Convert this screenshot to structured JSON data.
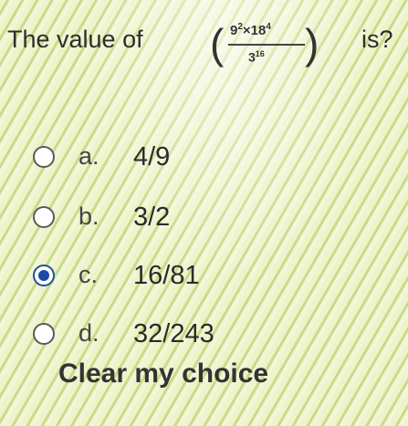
{
  "question": {
    "prefix": "The value of",
    "numerator_base1": "9",
    "numerator_exp1": "2",
    "numerator_times": "×",
    "numerator_base2": "18",
    "numerator_exp2": "4",
    "denominator_base": "3",
    "denominator_exp": "16",
    "left_paren": "(",
    "right_paren": ")",
    "suffix": "is?"
  },
  "options": [
    {
      "letter": "a.",
      "value": "4/9",
      "selected": false
    },
    {
      "letter": "b.",
      "value": "3/2",
      "selected": false
    },
    {
      "letter": "c.",
      "value": "16/81",
      "selected": true
    },
    {
      "letter": "d.",
      "value": "32/243",
      "selected": false
    }
  ],
  "clear_label": "Clear my choice",
  "colors": {
    "radio_selected": "#1a4aa8",
    "background": "#e4efb6"
  }
}
